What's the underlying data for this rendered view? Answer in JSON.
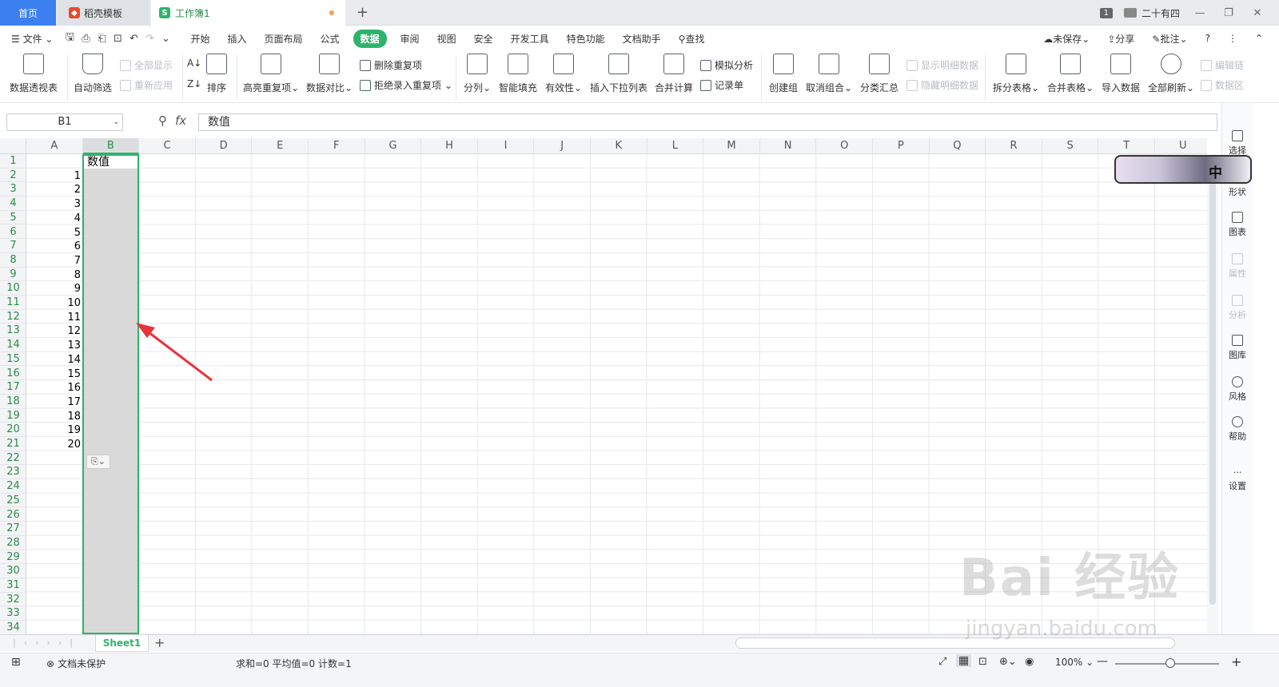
{
  "tabs": {
    "home": "首页",
    "daoke": "稻壳模板",
    "workbook": "工作簿1",
    "new_tab": "+"
  },
  "titlebar_right": {
    "badge": "1",
    "user": "二十有四"
  },
  "menu": {
    "file": "文件",
    "items": [
      "开始",
      "插入",
      "页面布局",
      "公式",
      "数据",
      "审阅",
      "视图",
      "安全",
      "开发工具",
      "特色功能",
      "文档助手"
    ],
    "active": "数据",
    "search": "查找",
    "unsaved": "未保存",
    "share": "分享",
    "annotate": "批注"
  },
  "ribbon": {
    "pivot": "数据透视表",
    "autofilter": "自动筛选",
    "show_all": "全部显示",
    "reapply": "重新应用",
    "sort": "排序",
    "highlight_dup": "高亮重复项",
    "compare": "数据对比",
    "remove_dup": "删除重复项",
    "reject_dup": "拒绝录入重复项",
    "split_col": "分列",
    "smart_fill": "智能填充",
    "validity": "有效性",
    "insert_dropdown": "插入下拉列表",
    "consolidate": "合并计算",
    "whatif": "模拟分析",
    "record": "记录单",
    "group": "创建组",
    "ungroup": "取消组合",
    "subtotal": "分类汇总",
    "show_detail": "显示明细数据",
    "hide_detail": "隐藏明细数据",
    "split_table": "拆分表格",
    "merge_table": "合并表格",
    "import": "导入数据",
    "refresh_all": "全部刷新",
    "edit_link": "编辑链",
    "data_area": "数据区"
  },
  "formula_bar": {
    "cell_ref": "B1",
    "fx": "fx",
    "value": "数值"
  },
  "columns": [
    "A",
    "B",
    "C",
    "D",
    "E",
    "F",
    "G",
    "H",
    "I",
    "J",
    "K",
    "L",
    "M",
    "N",
    "O",
    "P",
    "Q",
    "R",
    "S",
    "T",
    "U"
  ],
  "selected_column": "B",
  "rows": [
    "1",
    "2",
    "3",
    "4",
    "5",
    "6",
    "7",
    "8",
    "9",
    "10",
    "11",
    "12",
    "13",
    "14",
    "15",
    "16",
    "17",
    "18",
    "19",
    "20",
    "21",
    "22",
    "23",
    "24",
    "25",
    "26",
    "27",
    "28",
    "29",
    "30",
    "31",
    "32",
    "33",
    "34"
  ],
  "cells": {
    "B1": "数值",
    "A": [
      "1",
      "2",
      "3",
      "4",
      "5",
      "6",
      "7",
      "8",
      "9",
      "10",
      "11",
      "12",
      "13",
      "14",
      "15",
      "16",
      "17",
      "18",
      "19",
      "20"
    ]
  },
  "right_panel": {
    "select": "选择",
    "shape": "形状",
    "chart": "图表",
    "attr": "属性",
    "analysis": "分析",
    "gallery": "图库",
    "style": "风格",
    "help": "帮助",
    "settings": "设置"
  },
  "avatar_char": "中",
  "sheet_tab": "Sheet1",
  "status": {
    "protect": "文档未保护",
    "summary": "求和=0  平均值=0  计数=1",
    "zoom": "100%"
  },
  "watermark": {
    "main": "Bai 经验",
    "sub": "jingyan.baidu.com"
  },
  "colors": {
    "accent": "#2eb36c",
    "home_tab": "#3c7ff0",
    "arrow": "#e8333a"
  }
}
